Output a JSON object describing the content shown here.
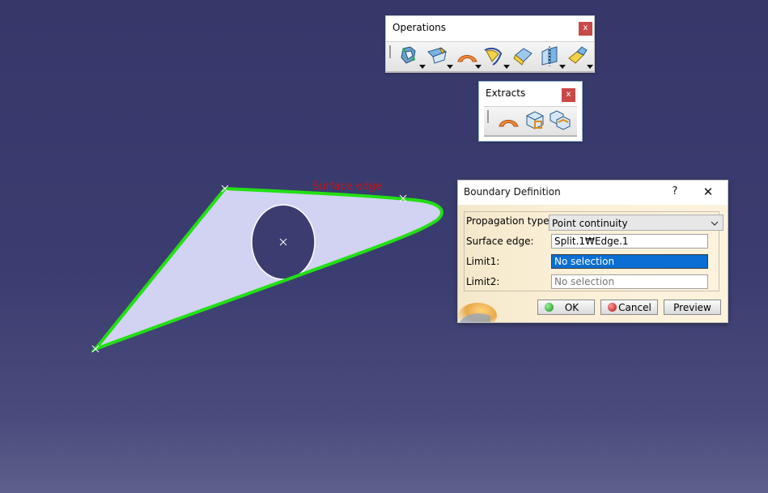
{
  "toolbars": {
    "operations": {
      "title": "Operations",
      "close_label": "x",
      "tools": [
        "join-tool",
        "healing-tool",
        "untrim-tool",
        "boundary-tool",
        "extract-tool",
        "split-tool",
        "transform-tool"
      ]
    },
    "extracts": {
      "title": "Extracts",
      "close_label": "x",
      "tools": [
        "boundary-tool",
        "extract-tool",
        "multiple-extract-tool"
      ]
    }
  },
  "geometry": {
    "label": "Surface edge",
    "surface_fill": "#d2d2f2",
    "edge_color": "#22e014",
    "label_color": "#c01616"
  },
  "dialog": {
    "title": "Boundary Definition",
    "help_label": "?",
    "close_label": "✕",
    "propagation_label": "Propagation type:",
    "propagation_value": "Point continuity",
    "surface_edge_label": "Surface edge:",
    "surface_edge_value": "Split.1₩Edge.1",
    "limit1_label": "Limit1:",
    "limit1_value": "No selection",
    "limit2_label": "Limit2:",
    "limit2_value": "No selection",
    "ok_label": "OK",
    "cancel_label": "Cancel",
    "preview_label": "Preview"
  },
  "colors": {
    "background": "#3b3d70",
    "selection": "#0a6ed4",
    "dialog_body": "#fbefd7",
    "close_button": "#c84a48"
  }
}
